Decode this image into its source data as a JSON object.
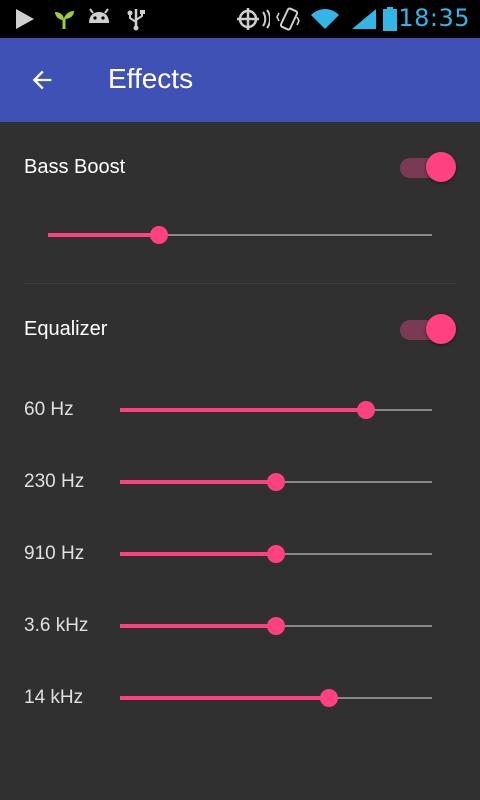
{
  "status_bar": {
    "time": "18:35",
    "icons": [
      "play-icon",
      "plant-icon",
      "android-icon",
      "usb-icon",
      "sync-icon",
      "vibrate-icon",
      "wifi-icon",
      "signal-icon",
      "battery-icon"
    ]
  },
  "toolbar": {
    "title": "Effects",
    "back_icon": "arrow-back-icon",
    "color": "#3f51b5"
  },
  "bass_boost": {
    "label": "Bass Boost",
    "enabled": true,
    "level": 0.29
  },
  "equalizer": {
    "label": "Equalizer",
    "enabled": true,
    "bands": [
      {
        "label": "60 Hz",
        "level": 0.79
      },
      {
        "label": "230 Hz",
        "level": 0.5
      },
      {
        "label": "910 Hz",
        "level": 0.5
      },
      {
        "label": "3.6 kHz",
        "level": 0.5
      },
      {
        "label": "14 kHz",
        "level": 0.67
      }
    ]
  },
  "colors": {
    "accent": "#ff4081",
    "background": "#303030",
    "status_time": "#33b5e5"
  }
}
